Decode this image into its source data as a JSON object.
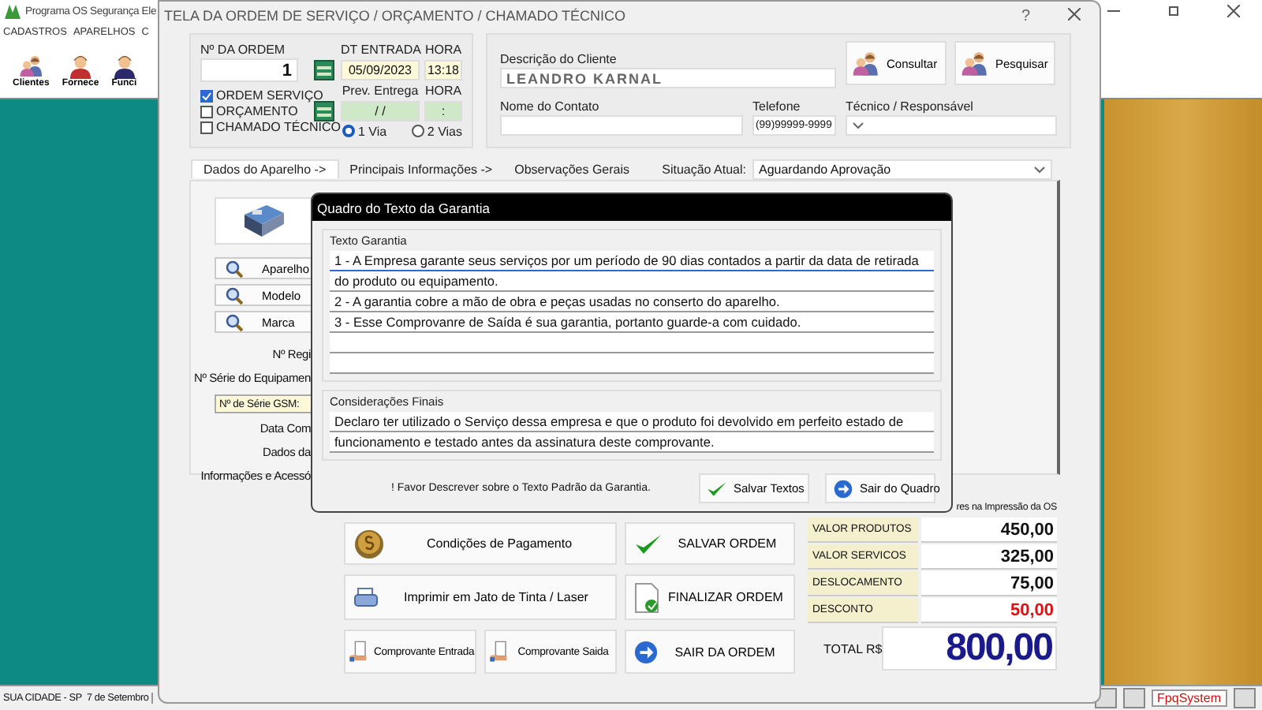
{
  "app": {
    "title": "Programa OS Segurança Ele",
    "menu": [
      "CADASTROS",
      "APARELHOS",
      "C"
    ],
    "toolbar": [
      "Clientes",
      "Fornece",
      "Funci"
    ],
    "status_bar": {
      "location": "SUA CIDADE - SP  7 de Setembro",
      "brand": "FpqSystem"
    }
  },
  "order_window": {
    "title": "TELA DA ORDEM DE SERVIÇO / ORÇAMENTO / CHAMADO TÉCNICO",
    "help": "?",
    "order": {
      "label": "Nº DA ORDEM",
      "value": "1"
    },
    "types": [
      {
        "label": "ORDEM SERVIÇO",
        "checked": true
      },
      {
        "label": "ORÇAMENTO",
        "checked": false
      },
      {
        "label": "CHAMADO TÉCNICO",
        "checked": false
      }
    ],
    "entry": {
      "date_label": "DT ENTRADA",
      "date": "05/09/2023",
      "time_label": "HORA",
      "time": "13:18"
    },
    "forecast": {
      "date_label": "Prev. Entrega",
      "date": "/ /",
      "time_label": "HORA",
      "time": ":"
    },
    "copies": [
      {
        "label": "1 Via",
        "selected": true
      },
      {
        "label": "2 Vias",
        "selected": false
      }
    ],
    "client": {
      "description_label": "Descrição do Cliente",
      "description": "LEANDRO KARNAL",
      "contact_label": "Nome do Contato",
      "phone_label": "Telefone",
      "phone": "(99)99999-9999",
      "technician_label": "Técnico / Responsável"
    },
    "client_buttons": [
      "Consultar",
      "Pesquisar"
    ],
    "tabs": [
      {
        "label": "Dados do Aparelho ->",
        "selected": true
      },
      {
        "label": "Principais Informações ->",
        "selected": false
      },
      {
        "label": "Observações Gerais",
        "selected": false
      }
    ],
    "status": {
      "label": "Situação Atual:",
      "value": "Aguardando Aprovação"
    },
    "device_buttons": [
      "Aparelho",
      "Modelo",
      "Marca"
    ],
    "device_fields": [
      {
        "label": "Nº Regi",
        "kind": "label"
      },
      {
        "label": "Nº Série do Equipamen",
        "kind": "label"
      },
      {
        "label": "Nº de Série GSM:",
        "kind": "field"
      },
      {
        "label": "Data Com",
        "kind": "label"
      },
      {
        "label": "Dados da",
        "kind": "label"
      },
      {
        "label": "Informações e Acessó",
        "kind": "label"
      }
    ],
    "actions": [
      {
        "label": "Condições de Pagamento",
        "kind": "payment"
      },
      {
        "label": "SALVAR ORDEM",
        "kind": "save"
      },
      {
        "label": "Imprimir em Jato de Tinta / Laser",
        "kind": "print"
      },
      {
        "label": "FINALIZAR ORDEM",
        "kind": "finalize"
      },
      {
        "label": "Comprovante Entrada",
        "kind": "receipt"
      },
      {
        "label": "Comprovante Saida",
        "kind": "receipt"
      },
      {
        "label": "SAIR DA ORDEM",
        "kind": "exit"
      }
    ],
    "totals": {
      "caption": "res na Impressão da OS",
      "rows": [
        {
          "label": "VALOR PRODUTOS",
          "value": "450,00",
          "negative": false
        },
        {
          "label": "VALOR SERVICOS",
          "value": "325,00",
          "negative": false
        },
        {
          "label": "DESLOCAMENTO",
          "value": "75,00",
          "negative": false
        },
        {
          "label": "DESCONTO",
          "value": "50,00",
          "negative": true
        }
      ],
      "total_label": "TOTAL R$",
      "total": "800,00"
    }
  },
  "warranty_dialog": {
    "title": "Quadro do Texto da Garantia",
    "warranty_label": "Texto Garantia",
    "warranty_lines": [
      "1 - A Empresa garante seus serviços por um período de 90 dias contados a partir da data de retirada",
      "do produto ou equipamento.",
      "2 - A garantia cobre a mão de obra e peças usadas no conserto do aparelho.",
      "3 - Esse Comprovanre de Saída é sua garantia, portanto guarde-a com cuidado."
    ],
    "final_label": "Considerações Finais",
    "final_lines": [
      "Declaro ter utilizado o Serviço dessa empresa e que o produto foi devolvido em perfeito estado de",
      "funcionamento e testado antes da assinatura deste comprovante."
    ],
    "note": "! Favor Descrever sobre o Texto Padrão da Garantia.",
    "buttons": [
      {
        "label": "Salvar Textos",
        "kind": "save"
      },
      {
        "label": "Sair do Quadro",
        "kind": "exit"
      }
    ]
  }
}
